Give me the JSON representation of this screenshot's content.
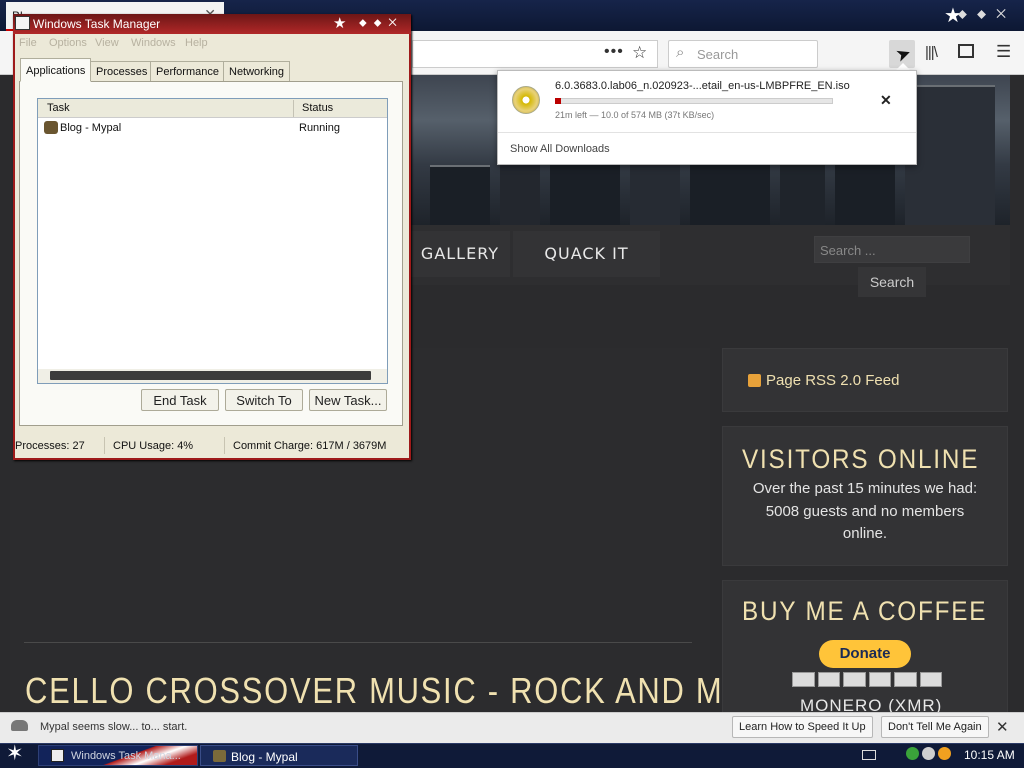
{
  "browser": {
    "tab_title": "Bl...",
    "search_placeholder": "Search",
    "url_dots": "•••",
    "downloads": {
      "file_name": "6.0.3683.0.lab06_n.020923-...etail_en-us-LMBPFRE_EN.iso",
      "status": "21m left — 10.0 of 574 MB (37t KB/sec)",
      "progress_fraction": 0.02,
      "show_all": "Show All Downloads"
    }
  },
  "site": {
    "nav": [
      {
        "label": "GALLERY"
      },
      {
        "label": "QUACK IT"
      }
    ],
    "search_placeholder": "Search ...",
    "search_button": "Search",
    "rss_label": "Page RSS 2.0 Feed",
    "visitors_title": "VISITORS ONLINE",
    "visitors_text": "Over the past 15 minutes we had: 5008 guests and no members online.",
    "coffee_title": "BUY ME A COFFEE",
    "donate_label": "Donate",
    "monero_label": "MONERO (XMR)",
    "post_title": "CELLO CROSSOVER MUSIC - ROCK AND METAL"
  },
  "task_manager": {
    "title": "Windows Task Manager",
    "menu": [
      "File",
      "Options",
      "View",
      "Windows",
      "Help"
    ],
    "tabs": [
      "Applications",
      "Processes",
      "Performance",
      "Networking"
    ],
    "columns": {
      "task": "Task",
      "status": "Status"
    },
    "rows": [
      {
        "task": "Blog - Mypal",
        "status": "Running"
      }
    ],
    "buttons": {
      "end_task": "End Task",
      "switch_to": "Switch To",
      "new_task": "New Task..."
    },
    "status": {
      "processes": "Processes: 27",
      "cpu": "CPU Usage: 4%",
      "commit": "Commit Charge: 617M / 3679M"
    }
  },
  "notification": {
    "text": "Mypal seems slow... to... start.",
    "learn_btn": "Learn How to Speed It Up",
    "dismiss_btn": "Don't Tell Me Again"
  },
  "taskbar": {
    "items": [
      {
        "label": "Windows Task Mana..."
      },
      {
        "label": "Blog - Mypal"
      }
    ],
    "clock": "10:15 AM"
  },
  "colors": {
    "accent_gold": "#f0e1b0",
    "tm_title_red": "#9e1a1a",
    "download_progress": "#bb0000",
    "taskbar_navy": "#0f1a38"
  }
}
